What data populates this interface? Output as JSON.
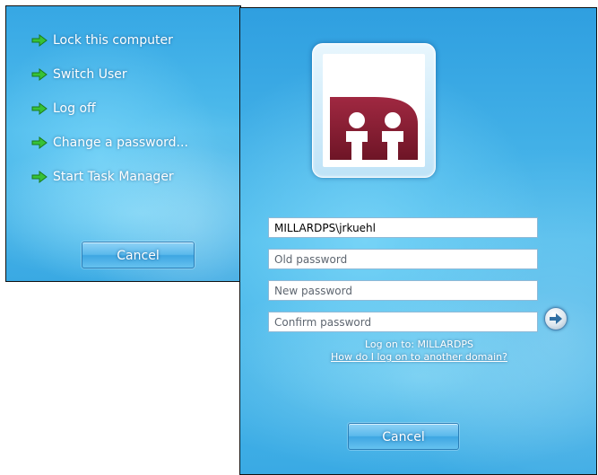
{
  "cad_menu": {
    "options": [
      "Lock this computer",
      "Switch User",
      "Log off",
      "Change a password...",
      "Start Task Manager"
    ],
    "option_icon": "green-arrow-icon",
    "cancel_label": "Cancel"
  },
  "change_password": {
    "user_tile_icon": "organization-logo",
    "username_value": "MILLARDPS\\jrkuehl",
    "old_password_placeholder": "Old password",
    "new_password_placeholder": "New password",
    "confirm_password_placeholder": "Confirm password",
    "submit_icon": "arrow-right-icon",
    "logon_to": "Log on to: MILLARDPS",
    "other_domain_link": "How do I log on to another domain?",
    "cancel_label": "Cancel"
  },
  "colors": {
    "background_blue": "#3aa9e3",
    "logo_maroon": "#8a1c33",
    "arrow_green": "#2fb82f"
  }
}
